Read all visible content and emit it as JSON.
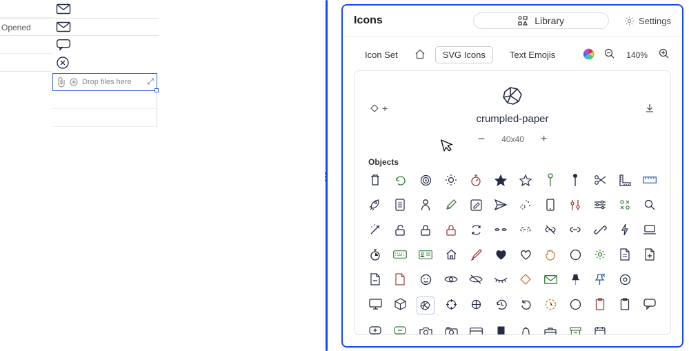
{
  "left": {
    "opened_label": "Opened",
    "drop_placeholder": "Drop files here"
  },
  "panel": {
    "title": "Icons",
    "library_label": "Library",
    "settings_label": "Settings"
  },
  "tabs": {
    "icon_set": "Icon Set",
    "svg_icons": "SVG Icons",
    "text_emojis": "Text Emojis"
  },
  "zoom": {
    "value": "140%"
  },
  "preview": {
    "name": "crumpled-paper",
    "size": "40x40"
  },
  "section": {
    "objects": "Objects"
  },
  "icons": {
    "row1": [
      "trash",
      "reload",
      "target",
      "sun",
      "stopwatch",
      "star-filled",
      "star",
      "pin-outline",
      "pin-filled",
      "scissors",
      "ruler-corner",
      "ruler"
    ],
    "row2": [
      "rocket",
      "clipboard",
      "person",
      "pencil",
      "note-edit",
      "send",
      "magic-dots",
      "phone",
      "sliders-v",
      "sliders-h",
      "grid-x",
      "search"
    ],
    "row3": [
      "wand",
      "lock-open",
      "lock",
      "lock-red",
      "refresh",
      "unlink",
      "unlink-dash",
      "no-link",
      "link",
      "chain",
      "bolt",
      "laptop"
    ],
    "row4": [
      "timer",
      "keyboard-green",
      "id-card-green",
      "home",
      "brush",
      "heart-filled",
      "heart",
      "hand",
      "circle",
      "gear-green",
      "doc-lines",
      "doc-plus"
    ],
    "row5": [
      "doc-dash",
      "doc",
      "smile",
      "eye",
      "eye-off",
      "lashes",
      "diamond",
      "mail",
      "pushpin",
      "pin-x",
      "circle-dot"
    ],
    "row6": [
      "monitor",
      "cube",
      "crumpled",
      "crosshair",
      "target2",
      "history",
      "rotate",
      "clock-dots",
      "circle2",
      "clipboard2",
      "clipboard3",
      "chat"
    ],
    "row7": [
      "chat-plus",
      "chat-dash",
      "camera",
      "camera2",
      "card",
      "bookmark-filled",
      "bell",
      "briefcase",
      "calendar",
      "calendar2"
    ]
  }
}
